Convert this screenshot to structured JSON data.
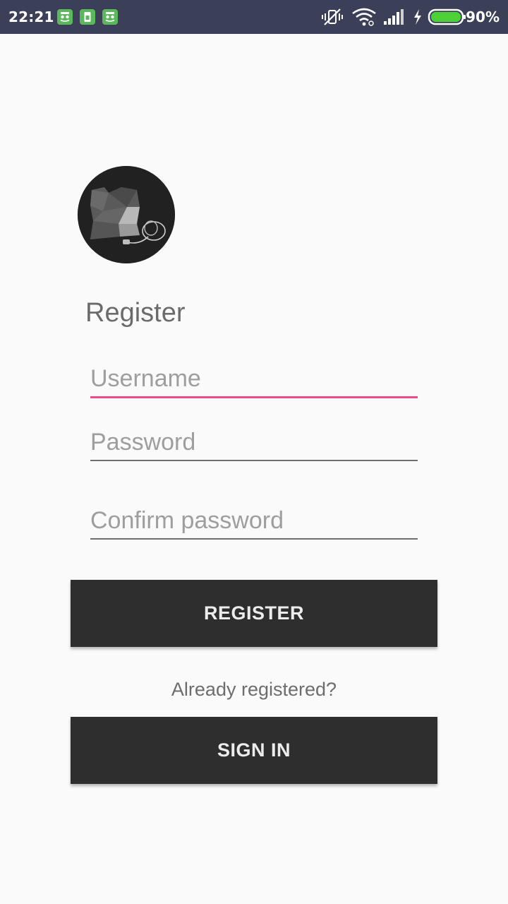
{
  "status_bar": {
    "time": "22:21",
    "battery_percent": "90%",
    "battery_level": 0.9,
    "icons": [
      "app-notification-icon",
      "sim-notification-icon",
      "app-notification-icon",
      "vibrate-off-icon",
      "wifi-icon",
      "signal-icon",
      "charging-icon",
      "battery-icon"
    ]
  },
  "form": {
    "title": "Register",
    "username_placeholder": "Username",
    "password_placeholder": "Password",
    "confirm_placeholder": "Confirm password",
    "register_label": "REGISTER",
    "already_text": "Already registered?",
    "signin_label": "SIGN IN"
  },
  "colors": {
    "status_bar": "#3b3f58",
    "accent": "#ec4d87",
    "button_bg": "#2e2e2e",
    "background": "#fafafa"
  }
}
